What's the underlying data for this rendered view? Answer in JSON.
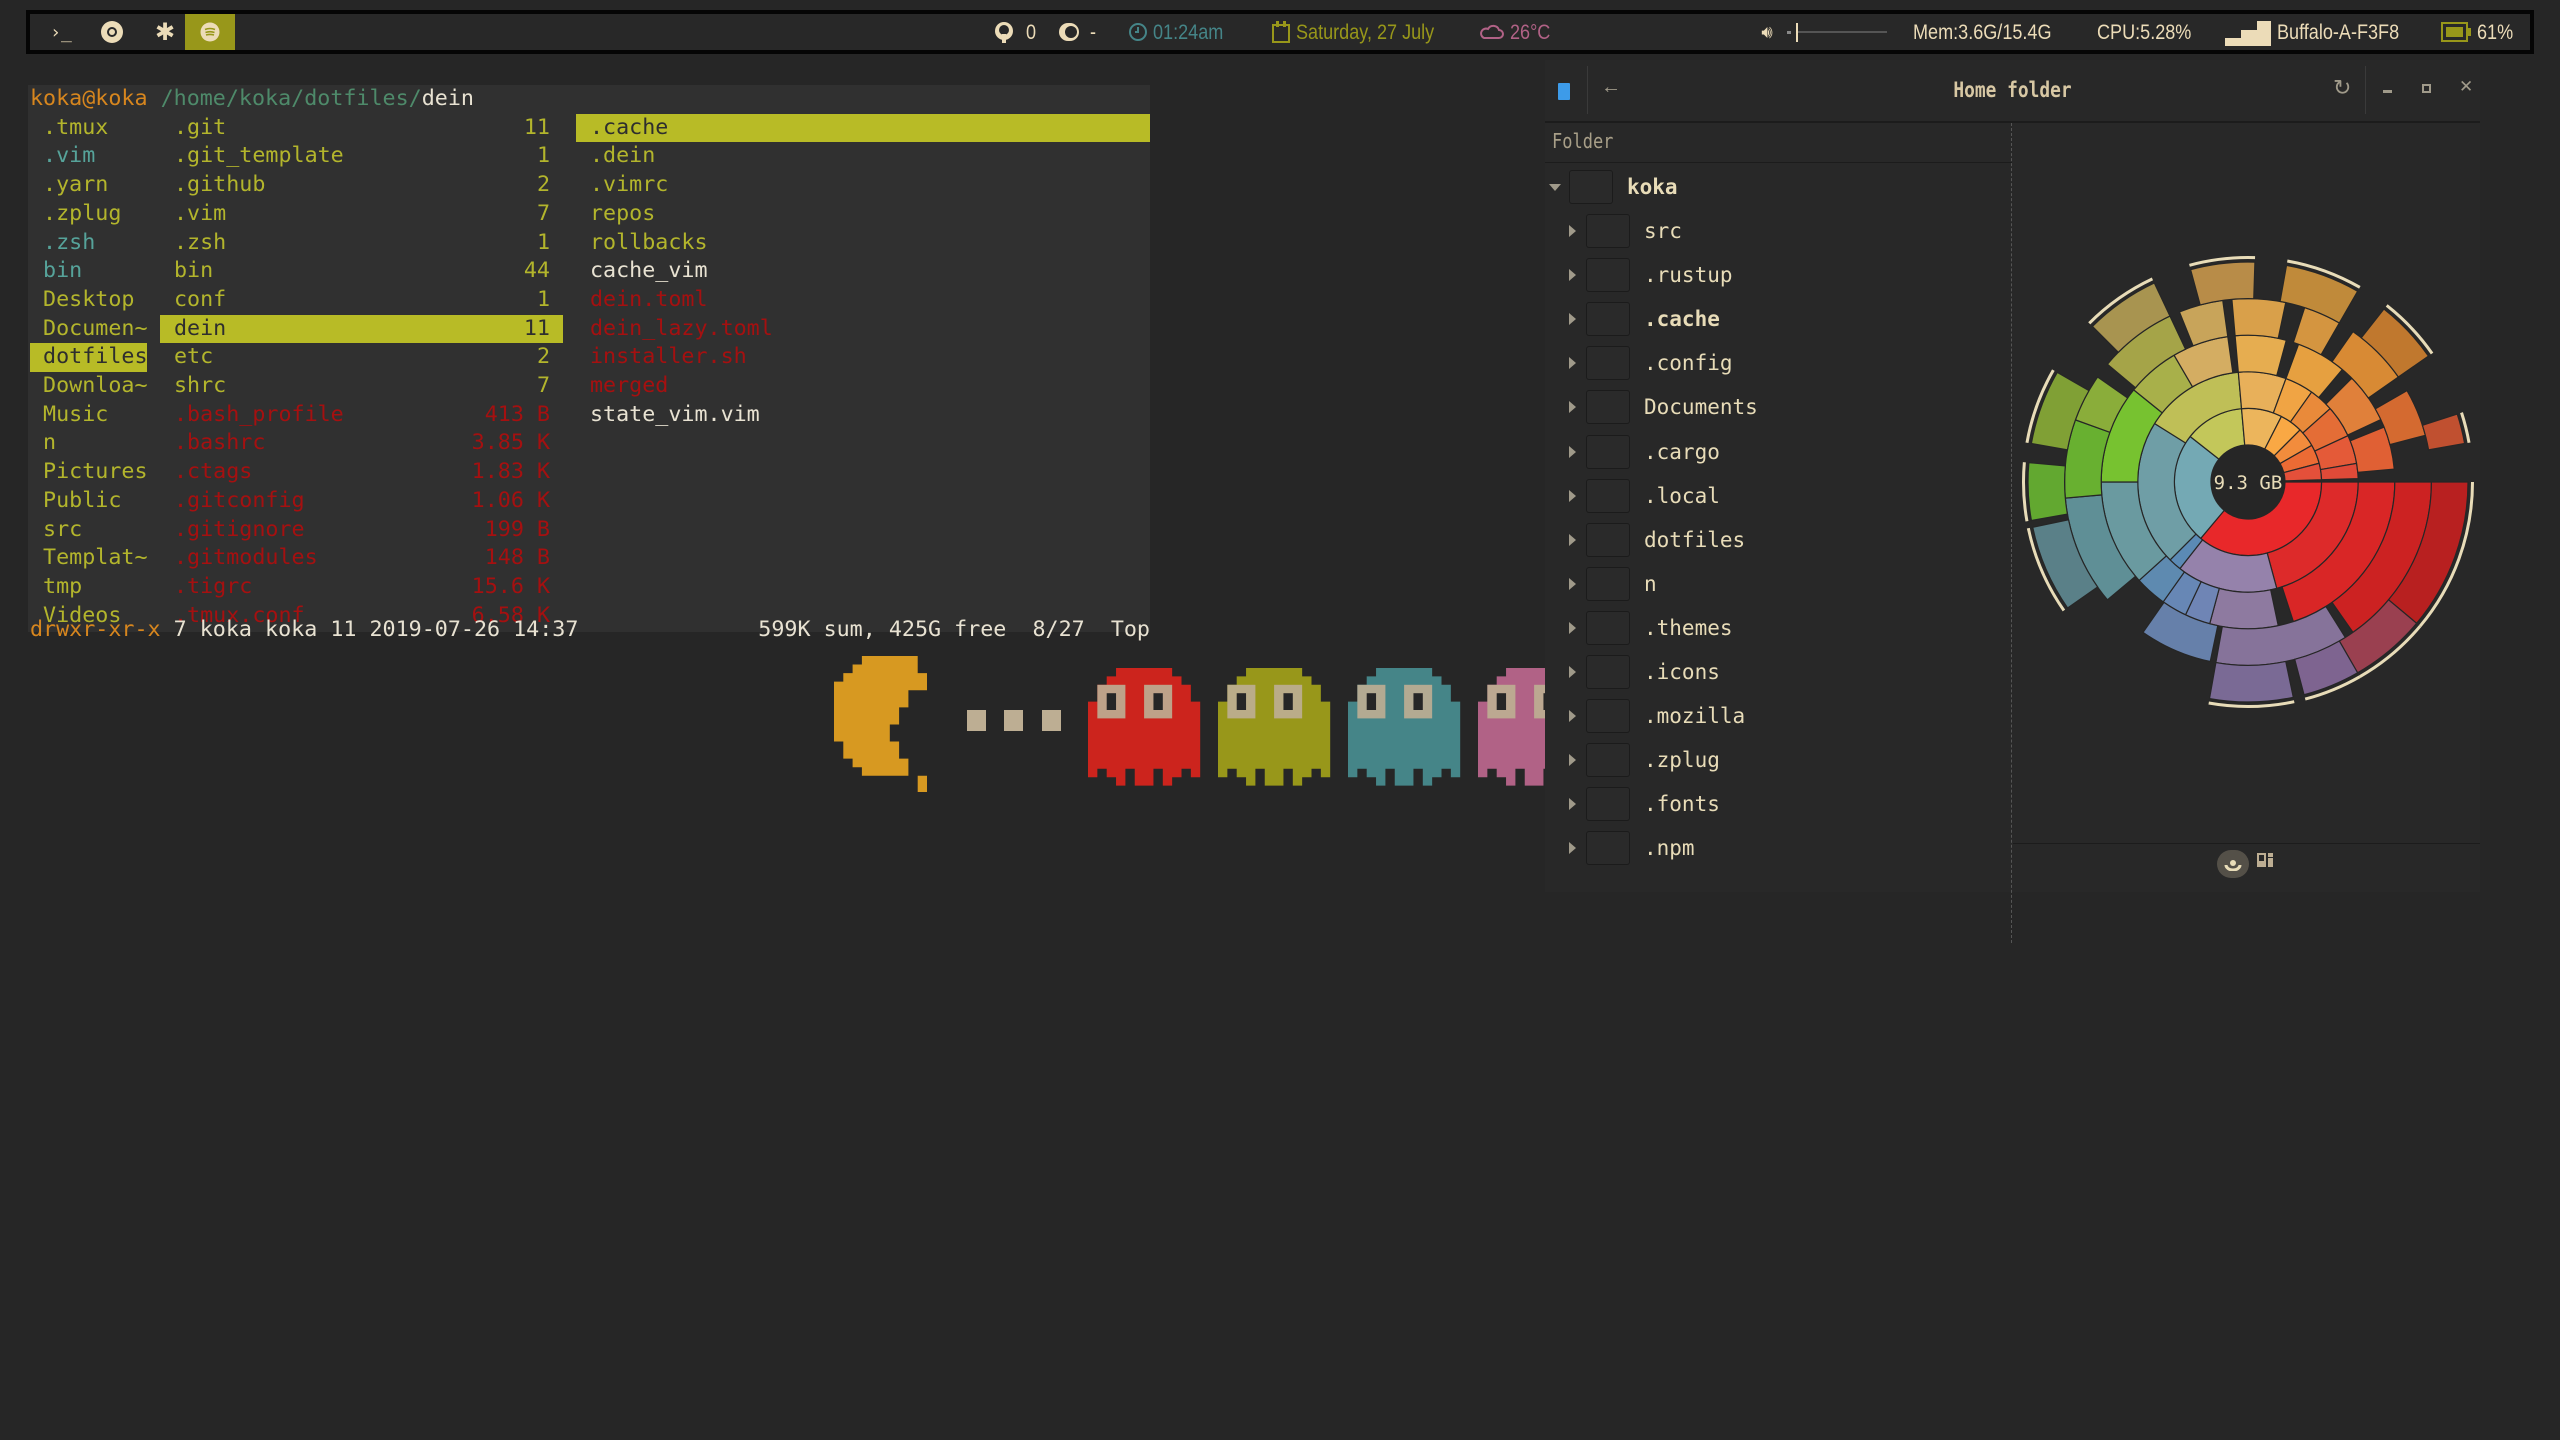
{
  "topbar": {
    "launchers": [
      {
        "icon": "terminal-icon"
      },
      {
        "icon": "chrome-icon"
      },
      {
        "icon": "gear-icon"
      },
      {
        "icon": "spotify-icon",
        "active": true
      }
    ],
    "github_count": "0",
    "toggle_value": "-",
    "time": "01:24am",
    "date": "Saturday, 27 July",
    "weather": "26°C",
    "volume_percent": 0,
    "memory": "Mem:3.6G/15.4G",
    "cpu": "CPU:5.28%",
    "wifi": "Buffalo-A-F3F8",
    "battery": "61%",
    "colors": {
      "accent": "#98971a",
      "time": "#458588",
      "date": "#98971a",
      "weather": "#b16286",
      "text": "#ebdbb2"
    }
  },
  "terminal": {
    "prompt_user": "koka@koka",
    "prompt_path": "/home/koka/dotfiles/",
    "prompt_current": "dein",
    "col1": [
      {
        "name": " .tmux",
        "kind": "y"
      },
      {
        "name": " .vim",
        "kind": "tl"
      },
      {
        "name": " .yarn",
        "kind": "y"
      },
      {
        "name": " .zplug",
        "kind": "y"
      },
      {
        "name": " .zsh",
        "kind": "tl"
      },
      {
        "name": " bin",
        "kind": "tl"
      },
      {
        "name": " Desktop",
        "kind": "y"
      },
      {
        "name": " Documen~",
        "kind": "y"
      },
      {
        "name": " dotfiles",
        "kind": "hl"
      },
      {
        "name": " Downloa~",
        "kind": "y"
      },
      {
        "name": " Music",
        "kind": "y"
      },
      {
        "name": " n",
        "kind": "y"
      },
      {
        "name": " Pictures",
        "kind": "y"
      },
      {
        "name": " Public",
        "kind": "y"
      },
      {
        "name": " src",
        "kind": "y"
      },
      {
        "name": " Templat~",
        "kind": "y"
      },
      {
        "name": " tmp",
        "kind": "y"
      },
      {
        "name": " Videos",
        "kind": "y"
      }
    ],
    "col2": [
      {
        "name": ".git",
        "size": "11",
        "kind": "y"
      },
      {
        "name": ".git_template",
        "size": "1",
        "kind": "y"
      },
      {
        "name": ".github",
        "size": "2",
        "kind": "y"
      },
      {
        "name": ".vim",
        "size": "7",
        "kind": "y"
      },
      {
        "name": ".zsh",
        "size": "1",
        "kind": "y"
      },
      {
        "name": "bin",
        "size": "44",
        "kind": "y"
      },
      {
        "name": "conf",
        "size": "1",
        "kind": "y"
      },
      {
        "name": "dein",
        "size": "11",
        "kind": "hl"
      },
      {
        "name": "etc",
        "size": "2",
        "kind": "y"
      },
      {
        "name": "shrc",
        "size": "7",
        "kind": "y"
      },
      {
        "name": ".bash_profile",
        "size": "413 B",
        "kind": "r"
      },
      {
        "name": ".bashrc",
        "size": "3.85 K",
        "kind": "r"
      },
      {
        "name": ".ctags",
        "size": "1.83 K",
        "kind": "r"
      },
      {
        "name": ".gitconfig",
        "size": "1.06 K",
        "kind": "r"
      },
      {
        "name": ".gitignore",
        "size": "199 B",
        "kind": "r"
      },
      {
        "name": ".gitmodules",
        "size": "148 B",
        "kind": "r"
      },
      {
        "name": ".tigrc",
        "size": "15.6 K",
        "kind": "r"
      },
      {
        "name": ".tmux.conf",
        "size": "6.58 K",
        "kind": "r"
      }
    ],
    "col3": [
      {
        "name": ".cache",
        "kind": "hl"
      },
      {
        "name": ".dein",
        "kind": "y"
      },
      {
        "name": ".vimrc",
        "kind": "y"
      },
      {
        "name": "repos",
        "kind": "y"
      },
      {
        "name": "rollbacks",
        "kind": "y"
      },
      {
        "name": "cache_vim",
        "kind": "w"
      },
      {
        "name": "dein.toml",
        "kind": "r"
      },
      {
        "name": "dein_lazy.toml",
        "kind": "r"
      },
      {
        "name": "installer.sh",
        "kind": "r"
      },
      {
        "name": "merged",
        "kind": "r"
      },
      {
        "name": "state_vim.vim",
        "kind": "w"
      }
    ],
    "status_perms": "drwxr-xr-x",
    "status_info": " 7 koka koka 11 2019-07-26 14:37",
    "status_right": "599K sum, 425G free  8/27  Top"
  },
  "baobab": {
    "title": "Home folder",
    "column_header": "Folder",
    "root": "koka",
    "folders": [
      "src",
      ".rustup",
      ".cache",
      ".config",
      "Documents",
      ".cargo",
      ".local",
      "dotfiles",
      "n",
      ".themes",
      ".icons",
      ".mozilla",
      ".zplug",
      ".fonts",
      ".npm"
    ],
    "bold_folder": ".cache"
  },
  "chart_data": {
    "type": "sunburst",
    "title": "",
    "center_label": "9.3 GB",
    "outline_color": "#e8dcb8",
    "segments": [
      {
        "level": 1,
        "start": 0.0,
        "size": 0.361,
        "color": "#e8282a"
      },
      {
        "level": 1,
        "start": 0.361,
        "size": 0.245,
        "color": "#74a9b4"
      },
      {
        "level": 1,
        "start": 0.606,
        "size": 0.13,
        "color": "#c3c75a"
      },
      {
        "level": 1,
        "start": 0.736,
        "size": 0.089,
        "color": "#ecb55c"
      },
      {
        "level": 1,
        "start": 0.825,
        "size": 0.05,
        "color": "#f9a844"
      },
      {
        "level": 1,
        "start": 0.875,
        "size": 0.042,
        "color": "#f28c3c"
      },
      {
        "level": 1,
        "start": 0.917,
        "size": 0.042,
        "color": "#ec6b34"
      },
      {
        "level": 1,
        "start": 0.959,
        "size": 0.036,
        "color": "#e4503a"
      },
      {
        "level": 2,
        "start": 0.0,
        "size": 0.208,
        "color": "#dd2a2a"
      },
      {
        "level": 2,
        "start": 0.208,
        "size": 0.148,
        "color": "#9582ab"
      },
      {
        "level": 2,
        "start": 0.356,
        "size": 0.019,
        "color": "#5b8ab5"
      },
      {
        "level": 2,
        "start": 0.375,
        "size": 0.214,
        "color": "#6f9ea6"
      },
      {
        "level": 2,
        "start": 0.589,
        "size": 0.147,
        "color": "#bfbf57"
      },
      {
        "level": 2,
        "start": 0.736,
        "size": 0.07,
        "color": "#e8b05a"
      },
      {
        "level": 2,
        "start": 0.806,
        "size": 0.042,
        "color": "#f0a444"
      },
      {
        "level": 2,
        "start": 0.848,
        "size": 0.036,
        "color": "#e98a3a"
      },
      {
        "level": 2,
        "start": 0.884,
        "size": 0.047,
        "color": "#e46d36"
      },
      {
        "level": 2,
        "start": 0.931,
        "size": 0.042,
        "color": "#e45a38"
      },
      {
        "level": 2,
        "start": 0.973,
        "size": 0.022,
        "color": "#e04a38"
      },
      {
        "level": 3,
        "start": 0.0,
        "size": 0.2,
        "color": "#d92626"
      },
      {
        "level": 3,
        "start": 0.217,
        "size": 0.075,
        "color": "#8e7aa0"
      },
      {
        "level": 3,
        "start": 0.292,
        "size": 0.028,
        "color": "#6f85b5"
      },
      {
        "level": 3,
        "start": 0.32,
        "size": 0.028,
        "color": "#6787b5"
      },
      {
        "level": 3,
        "start": 0.348,
        "size": 0.035,
        "color": "#5e8ab0"
      },
      {
        "level": 3,
        "start": 0.383,
        "size": 0.117,
        "color": "#6a9aa0"
      },
      {
        "level": 3,
        "start": 0.5,
        "size": 0.108,
        "color": "#77c230"
      },
      {
        "level": 3,
        "start": 0.608,
        "size": 0.058,
        "color": "#a8b04a"
      },
      {
        "level": 3,
        "start": 0.666,
        "size": 0.062,
        "color": "#d4ad62"
      },
      {
        "level": 3,
        "start": 0.736,
        "size": 0.056,
        "color": "#e6ad50"
      },
      {
        "level": 3,
        "start": 0.806,
        "size": 0.055,
        "color": "#e6a040"
      },
      {
        "level": 3,
        "start": 0.875,
        "size": 0.055,
        "color": "#e0803a"
      },
      {
        "level": 3,
        "start": 0.939,
        "size": 0.047,
        "color": "#e06034"
      },
      {
        "level": 4,
        "start": 0.0,
        "size": 0.153,
        "color": "#cc2222"
      },
      {
        "level": 4,
        "start": 0.161,
        "size": 0.117,
        "color": "#86739a"
      },
      {
        "level": 4,
        "start": 0.283,
        "size": 0.064,
        "color": "#6680aa"
      },
      {
        "level": 4,
        "start": 0.389,
        "size": 0.097,
        "color": "#5f8f96"
      },
      {
        "level": 4,
        "start": 0.486,
        "size": 0.069,
        "color": "#68b030"
      },
      {
        "level": 4,
        "start": 0.555,
        "size": 0.042,
        "color": "#8aad3a"
      },
      {
        "level": 4,
        "start": 0.611,
        "size": 0.069,
        "color": "#a5a448"
      },
      {
        "level": 4,
        "start": 0.689,
        "size": 0.039,
        "color": "#c8a45a"
      },
      {
        "level": 4,
        "start": 0.736,
        "size": 0.047,
        "color": "#d9a04a"
      },
      {
        "level": 4,
        "start": 0.8,
        "size": 0.033,
        "color": "#d49540"
      },
      {
        "level": 4,
        "start": 0.847,
        "size": 0.056,
        "color": "#d88a34"
      },
      {
        "level": 4,
        "start": 0.917,
        "size": 0.042,
        "color": "#d46a30"
      },
      {
        "level": 5,
        "start": 0.0,
        "size": 0.111,
        "color": "#b82020"
      },
      {
        "level": 5,
        "start": 0.111,
        "size": 0.056,
        "color": "#9a4050"
      },
      {
        "level": 5,
        "start": 0.167,
        "size": 0.042,
        "color": "#7e6490"
      },
      {
        "level": 5,
        "start": 0.217,
        "size": 0.061,
        "color": "#7a6a95"
      },
      {
        "level": 5,
        "start": 0.403,
        "size": 0.064,
        "color": "#5a8088"
      },
      {
        "level": 5,
        "start": 0.472,
        "size": 0.042,
        "color": "#62a830"
      },
      {
        "level": 5,
        "start": 0.528,
        "size": 0.055,
        "color": "#80a035"
      },
      {
        "level": 5,
        "start": 0.625,
        "size": 0.055,
        "color": "#a89450"
      },
      {
        "level": 5,
        "start": 0.708,
        "size": 0.047,
        "color": "#b88c48"
      },
      {
        "level": 5,
        "start": 0.778,
        "size": 0.055,
        "color": "#c08a3a"
      },
      {
        "level": 5,
        "start": 0.856,
        "size": 0.047,
        "color": "#c0782e"
      },
      {
        "level": 5,
        "start": 0.95,
        "size": 0.022,
        "color": "#c05030"
      }
    ]
  }
}
